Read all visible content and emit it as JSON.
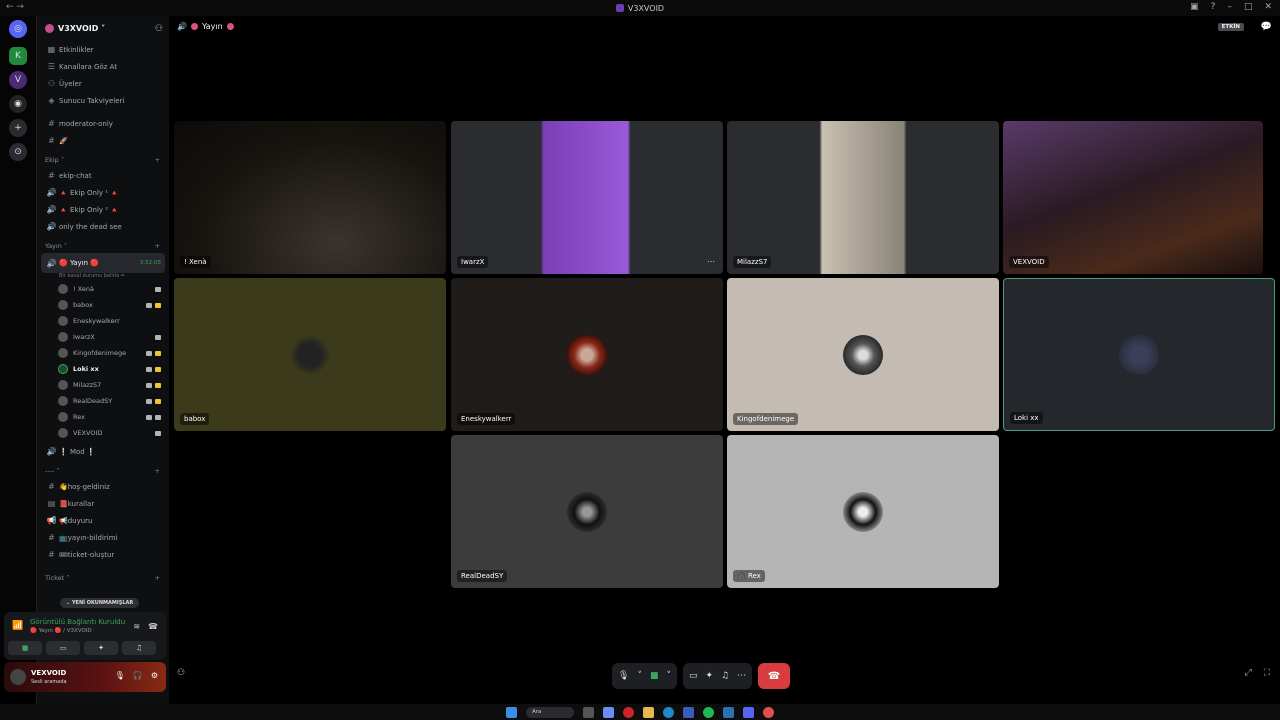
{
  "window": {
    "title": "V3XVOID"
  },
  "server": {
    "name": "V3XVOID"
  },
  "sidebar": {
    "top": [
      {
        "icon": "calendar-icon",
        "label": "Etkinlikler"
      },
      {
        "icon": "browse-icon",
        "label": "Kanallara Göz At"
      },
      {
        "icon": "members-icon",
        "label": "Üyeler"
      },
      {
        "icon": "boost-icon",
        "label": "Sunucu Takviyeleri"
      }
    ],
    "text1": [
      "moderator-only",
      "🚀"
    ],
    "ekip": {
      "title": "Ekip",
      "channels": [
        "ekip-chat",
        "🔺 Ekip Only ¹ 🔺",
        "🔺 Ekip Only ² 🔺",
        "only the dead see"
      ]
    },
    "yayin": {
      "title": "Yayın",
      "active": "🔴 Yayın 🔴",
      "time": "3:52:05",
      "status": "Bir kanal durumu belirle ✏",
      "members": [
        "! Xenà",
        "babox",
        "Eneskywalkerr",
        "IwarzX",
        "Kingofdenimege",
        "Loki xx",
        "MilazzS7",
        "RealDeadSY",
        "Rex",
        "VEXVOID"
      ]
    },
    "mod": "❕ Mod ❕",
    "dash": {
      "title": "----",
      "channels": [
        "👋hoş-geldiniz",
        "📕kurallar",
        "📢duyuru",
        "📺yayın-bildirimi",
        "🎟ticket-oluştur"
      ]
    },
    "ticket": {
      "title": "Ticket"
    },
    "new_messages": "YENİ OKUNMAMIŞLAR"
  },
  "voice": {
    "status": "Görüntülü Bağlantı Kuruldu",
    "sub": "🔴 Yayın 🔴 / V3XVOID"
  },
  "user": {
    "name": "VEXVOID",
    "status": "Sesli aramada"
  },
  "main": {
    "channel": "Yayın",
    "live": "ETKİN"
  },
  "tiles": [
    {
      "name": "! Xenà"
    },
    {
      "name": "IwarzX"
    },
    {
      "name": "MilazzS7"
    },
    {
      "name": "VEXVOID"
    },
    {
      "name": "babox"
    },
    {
      "name": "Eneskywalkerr"
    },
    {
      "name": "Kingofdenimege"
    },
    {
      "name": "Loki xx"
    },
    {
      "name": "RealDeadSY"
    },
    {
      "name": "Rex"
    }
  ],
  "taskbar": {
    "search": "Ara"
  },
  "colors": {
    "accent": "#3ba55d",
    "hangup": "#d83c3e",
    "highlight": "#4a9c7a"
  }
}
